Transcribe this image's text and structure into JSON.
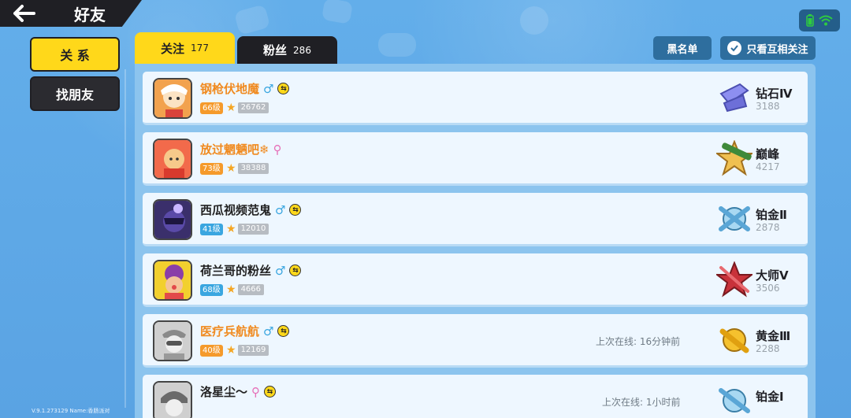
{
  "header": {
    "title": "好友",
    "back_icon": "back-arrow-icon"
  },
  "status": {
    "battery_icon": "battery-icon",
    "wifi_icon": "wifi-icon",
    "accent": "#2ecc40"
  },
  "nav": {
    "relations": "关 系",
    "find_friends": "找朋友"
  },
  "tabs": [
    {
      "label": "关注",
      "count": "177"
    },
    {
      "label": "粉丝",
      "count": "286"
    }
  ],
  "actions": {
    "blacklist": "黑名单",
    "mutual_only": "只看互相关注"
  },
  "friends": [
    {
      "name": "钢枪伏地魔",
      "gender": "♂",
      "level": "66级",
      "score": "26762",
      "online": "",
      "rank": "钻石Ⅳ",
      "points": "3188"
    },
    {
      "name": "放过魍魉吧❄",
      "gender": "⚲",
      "level": "73级",
      "score": "38388",
      "online": "",
      "rank": "巅峰",
      "points": "4217"
    },
    {
      "name": "西瓜视频范鬼",
      "gender": "♂",
      "level": "41级",
      "score": "12010",
      "online": "",
      "rank": "铂金Ⅱ",
      "points": "2878"
    },
    {
      "name": "荷兰哥的粉丝",
      "gender": "♂",
      "level": "68级",
      "score": "4666",
      "online": "",
      "rank": "大师Ⅴ",
      "points": "3506"
    },
    {
      "name": "医疗兵航航",
      "gender": "♂",
      "level": "40级",
      "score": "12169",
      "online": "上次在线: 16分钟前",
      "rank": "黄金Ⅲ",
      "points": "2288"
    },
    {
      "name": "洛星尘～",
      "gender": "⚲",
      "level": "",
      "score": "",
      "online": "上次在线: 1小时前",
      "rank": "铂金Ⅰ",
      "points": ""
    }
  ],
  "footer": {
    "version": "V.9.1.273129 Name:香肠派对"
  }
}
